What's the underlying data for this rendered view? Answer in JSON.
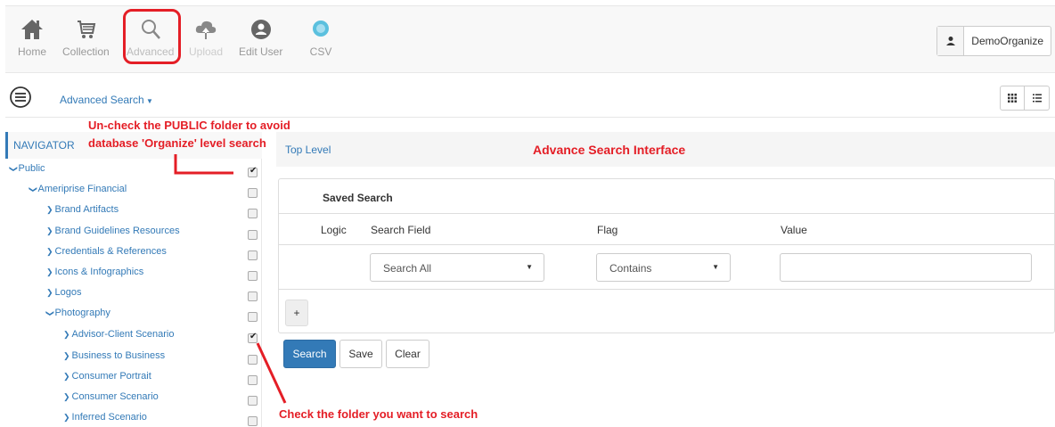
{
  "toolbar": {
    "items": [
      {
        "label": "Home",
        "icon": "home-icon"
      },
      {
        "label": "Collection",
        "icon": "cart-icon"
      },
      {
        "label": "Advanced",
        "icon": "search-icon"
      },
      {
        "label": "Upload",
        "icon": "cloud-upload-icon"
      },
      {
        "label": "Edit User",
        "icon": "user-circle-icon"
      },
      {
        "label": "CSV",
        "icon": "globe-icon"
      }
    ],
    "user": "DemoOrganize"
  },
  "subbar": {
    "advanced_search": "Advanced Search"
  },
  "navigator": {
    "title": "NAVIGATOR",
    "items": [
      {
        "label": "Public",
        "expanded": true,
        "checked": true
      },
      {
        "label": "Ameriprise Financial",
        "expanded": true,
        "checked": false
      },
      {
        "label": "Brand Artifacts",
        "expanded": false,
        "checked": false
      },
      {
        "label": "Brand Guidelines Resources",
        "expanded": false,
        "checked": false
      },
      {
        "label": "Credentials & References",
        "expanded": false,
        "checked": false
      },
      {
        "label": "Icons & Infographics",
        "expanded": false,
        "checked": false
      },
      {
        "label": "Logos",
        "expanded": false,
        "checked": false
      },
      {
        "label": "Photography",
        "expanded": true,
        "checked": false
      },
      {
        "label": "Advisor-Client Scenario",
        "expanded": false,
        "checked": true
      },
      {
        "label": "Business to Business",
        "expanded": false,
        "checked": false
      },
      {
        "label": "Consumer Portrait",
        "expanded": false,
        "checked": false
      },
      {
        "label": "Consumer Scenario",
        "expanded": false,
        "checked": false
      },
      {
        "label": "Inferred Scenario",
        "expanded": false,
        "checked": false
      }
    ]
  },
  "main": {
    "breadcrumb": "Top Level",
    "panel_title": "Saved Search",
    "headers": {
      "logic": "Logic",
      "search_field": "Search Field",
      "flag": "Flag",
      "value": "Value"
    },
    "search_field_value": "Search All",
    "flag_value": "Contains",
    "value_input": "",
    "add_label": "+",
    "buttons": {
      "search": "Search",
      "save": "Save",
      "clear": "Clear"
    }
  },
  "annotations": {
    "title": "Advance Search Interface",
    "uncheck_line1": "Un-check the PUBLIC folder to avoid",
    "uncheck_line2": "database 'Organize' level search",
    "check_folder": "Check the folder you want to search"
  },
  "colors": {
    "link": "#337ab7",
    "annotation": "#e41e26",
    "primary": "#337ab7"
  }
}
